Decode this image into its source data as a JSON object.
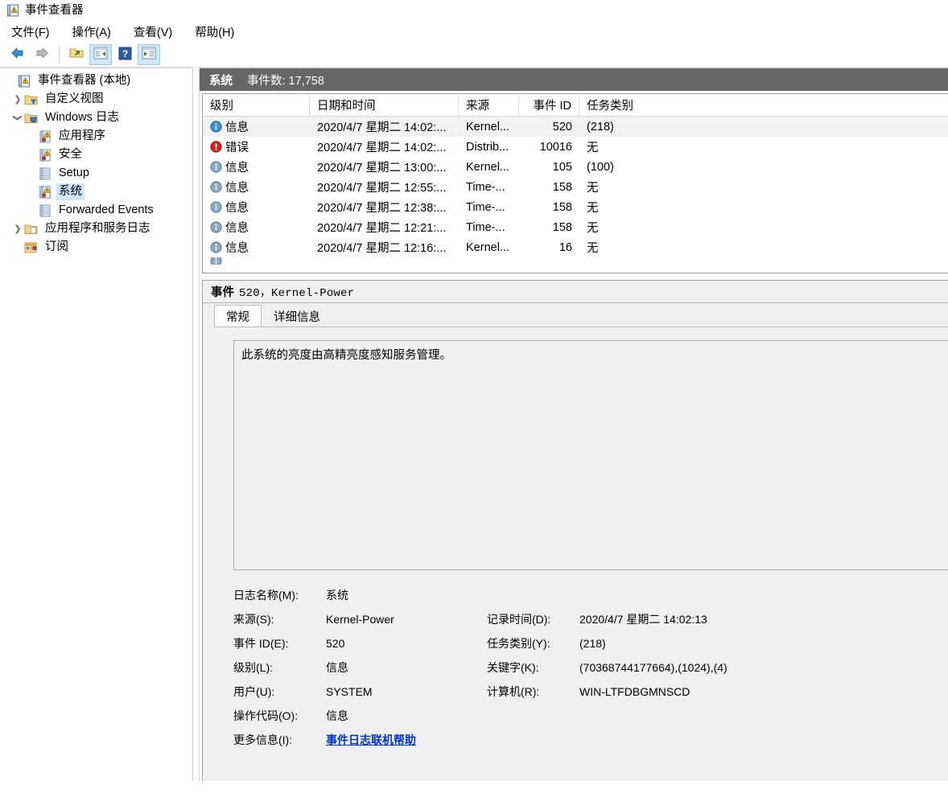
{
  "window": {
    "title": "事件查看器",
    "app_icon": "event-viewer-icon"
  },
  "menu": {
    "items": [
      {
        "label": "文件(F)",
        "name": "menu-file"
      },
      {
        "label": "操作(A)",
        "name": "menu-action"
      },
      {
        "label": "查看(V)",
        "name": "menu-view"
      },
      {
        "label": "帮助(H)",
        "name": "menu-help"
      }
    ]
  },
  "toolbar": {
    "buttons": [
      {
        "icon": "back-arrow-icon",
        "framed": false
      },
      {
        "icon": "forward-arrow-icon",
        "framed": false
      },
      {
        "icon": "open-saved-log-icon",
        "framed": false
      },
      {
        "icon": "show-hide-console-tree-icon",
        "framed": true
      },
      {
        "icon": "help-icon",
        "framed": false
      },
      {
        "icon": "show-hide-action-pane-icon",
        "framed": true
      }
    ]
  },
  "tree": {
    "nodes": [
      {
        "label": "事件查看器 (本地)",
        "icon": "event-viewer-icon",
        "indent": 0,
        "twisty": "",
        "selected": false
      },
      {
        "label": "自定义视图",
        "icon": "custom-views-folder-icon",
        "indent": 1,
        "twisty": "collapsed",
        "selected": false
      },
      {
        "label": "Windows 日志",
        "icon": "windows-logs-folder-icon",
        "indent": 1,
        "twisty": "expanded",
        "selected": false
      },
      {
        "label": "应用程序",
        "icon": "log-warning-icon",
        "indent": 2,
        "twisty": "",
        "selected": false
      },
      {
        "label": "安全",
        "icon": "log-warning-icon",
        "indent": 2,
        "twisty": "",
        "selected": false
      },
      {
        "label": "Setup",
        "icon": "log-plain-icon",
        "indent": 2,
        "twisty": "",
        "selected": false
      },
      {
        "label": "系统",
        "icon": "log-warning-icon",
        "indent": 2,
        "twisty": "",
        "selected": true
      },
      {
        "label": "Forwarded Events",
        "icon": "log-plain-icon",
        "indent": 2,
        "twisty": "",
        "selected": false
      },
      {
        "label": "应用程序和服务日志",
        "icon": "app-service-logs-folder-icon",
        "indent": 1,
        "twisty": "collapsed",
        "selected": false
      },
      {
        "label": "订阅",
        "icon": "subscriptions-icon",
        "indent": 1,
        "twisty": "",
        "selected": false
      }
    ]
  },
  "list": {
    "header_title": "系统",
    "header_count": "事件数: 17,758",
    "columns": [
      {
        "label": "级别",
        "key": "level",
        "align": "left"
      },
      {
        "label": "日期和时间",
        "key": "datetime",
        "align": "left"
      },
      {
        "label": "来源",
        "key": "source",
        "align": "left"
      },
      {
        "label": "事件 ID",
        "key": "event_id",
        "align": "right"
      },
      {
        "label": "任务类别",
        "key": "task_category",
        "align": "left"
      }
    ],
    "rows": [
      {
        "level": "信息",
        "level_icon": "information-icon",
        "datetime": "2020/4/7 星期二 14:02:...",
        "source": "Kernel...",
        "event_id": "520",
        "task_category": "(218)",
        "selected": true
      },
      {
        "level": "错误",
        "level_icon": "error-icon",
        "datetime": "2020/4/7 星期二 14:02:...",
        "source": "Distrib...",
        "event_id": "10016",
        "task_category": "无",
        "selected": false
      },
      {
        "level": "信息",
        "level_icon": "information-icon",
        "datetime": "2020/4/7 星期二 13:00:...",
        "source": "Kernel...",
        "event_id": "105",
        "task_category": "(100)",
        "selected": false
      },
      {
        "level": "信息",
        "level_icon": "information-icon",
        "datetime": "2020/4/7 星期二 12:55:...",
        "source": "Time-...",
        "event_id": "158",
        "task_category": "无",
        "selected": false
      },
      {
        "level": "信息",
        "level_icon": "information-icon",
        "datetime": "2020/4/7 星期二 12:38:...",
        "source": "Time-...",
        "event_id": "158",
        "task_category": "无",
        "selected": false
      },
      {
        "level": "信息",
        "level_icon": "information-icon",
        "datetime": "2020/4/7 星期二 12:21:...",
        "source": "Time-...",
        "event_id": "158",
        "task_category": "无",
        "selected": false
      },
      {
        "level": "信息",
        "level_icon": "information-icon",
        "datetime": "2020/4/7 星期二 12:16:...",
        "source": "Kernel...",
        "event_id": "16",
        "task_category": "无",
        "selected": false
      }
    ]
  },
  "detail": {
    "title_label": "事件",
    "title_value": "520，Kernel-Power",
    "tabs": [
      {
        "label": "常规",
        "active": true
      },
      {
        "label": "详细信息",
        "active": false
      }
    ],
    "description": "此系统的亮度由高精亮度感知服务管理。",
    "fields": [
      {
        "label": "日志名称(M):",
        "value": "系统",
        "label2": "",
        "value2": "",
        "link": false
      },
      {
        "label": "来源(S):",
        "value": "Kernel-Power",
        "label2": "记录时间(D):",
        "value2": "2020/4/7 星期二 14:02:13",
        "link": false
      },
      {
        "label": "事件 ID(E):",
        "value": "520",
        "label2": "任务类别(Y):",
        "value2": "(218)",
        "link": false
      },
      {
        "label": "级别(L):",
        "value": "信息",
        "label2": "关键字(K):",
        "value2": "(70368744177664),(1024),(4)",
        "link": false
      },
      {
        "label": "用户(U):",
        "value": "SYSTEM",
        "label2": "计算机(R):",
        "value2": "WIN-LTFDBGMNSCD",
        "link": false
      },
      {
        "label": "操作代码(O):",
        "value": "信息",
        "label2": "",
        "value2": "",
        "link": false
      },
      {
        "label": "更多信息(I):",
        "value": "事件日志联机帮助",
        "label2": "",
        "value2": "",
        "link": true
      }
    ]
  },
  "colors": {
    "header_bar_bg": "#666666",
    "selection_blue": "#cde8ff",
    "row_selected": "#f2f2f2",
    "link": "#0033cc",
    "error_red": "#cc1f1f",
    "info_blue": "#1e6fbf",
    "pane_bg": "#f0f0f0"
  }
}
